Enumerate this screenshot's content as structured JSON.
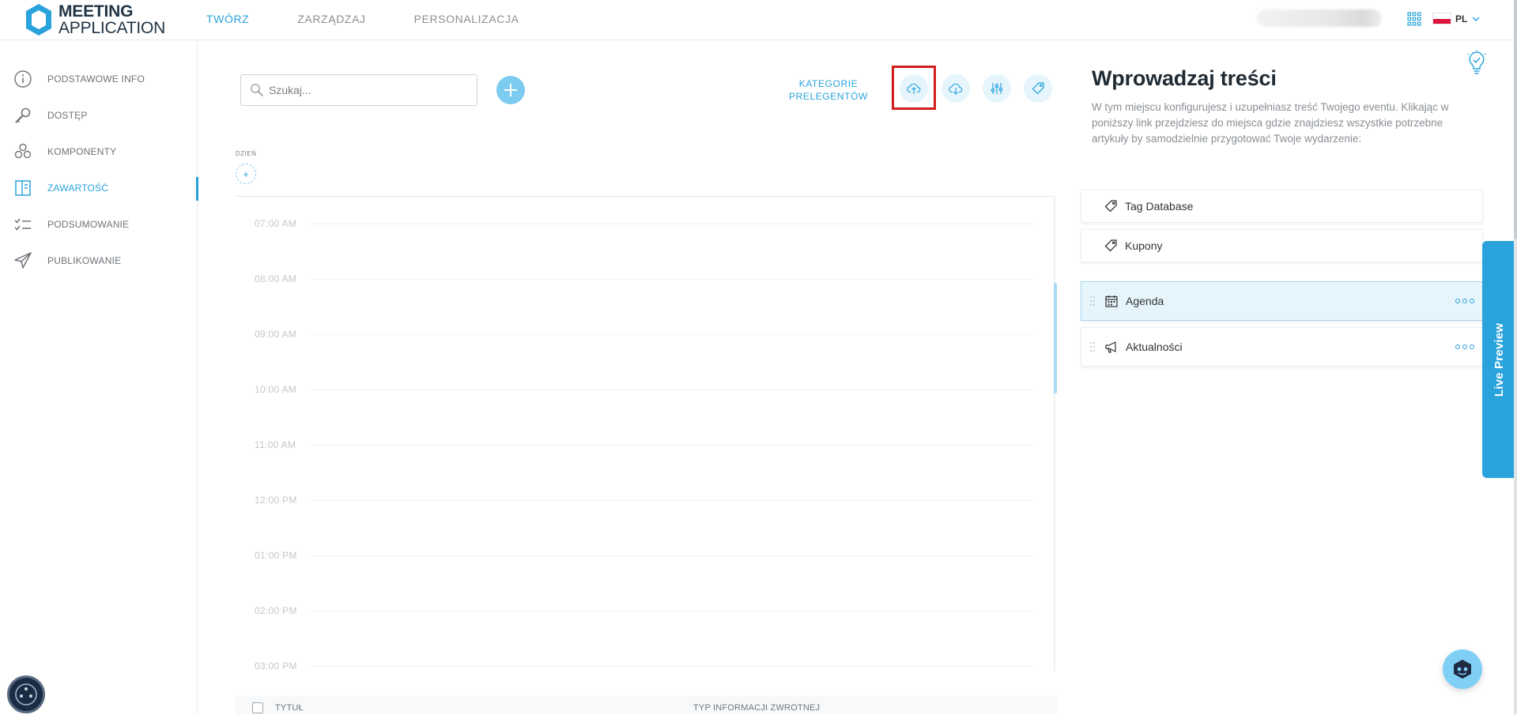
{
  "app": {
    "logo_line1": "MEETING",
    "logo_line2": "APPLICATION",
    "accent_color": "#2aa3dc"
  },
  "topnav": {
    "items": [
      {
        "label": "TWÓRZ",
        "active": true
      },
      {
        "label": "ZARZĄDZAJ",
        "active": false
      },
      {
        "label": "PERSONALIZACJA",
        "active": false
      }
    ]
  },
  "header_right": {
    "language": "PL",
    "icons": [
      "apps-grid-icon",
      "poland-flag-icon",
      "chevron-down-icon",
      "lightbulb-check-icon"
    ]
  },
  "sidebar": {
    "items": [
      {
        "label": "PODSTAWOWE INFO",
        "icon": "info-icon",
        "active": false
      },
      {
        "label": "DOSTĘP",
        "icon": "key-icon",
        "active": false
      },
      {
        "label": "KOMPONENTY",
        "icon": "components-icon",
        "active": false
      },
      {
        "label": "ZAWARTOŚĆ",
        "icon": "content-book-icon",
        "active": true
      },
      {
        "label": "PODSUMOWANIE",
        "icon": "checklist-icon",
        "active": false
      },
      {
        "label": "PUBLIKOWANIE",
        "icon": "paper-plane-icon",
        "active": false
      }
    ]
  },
  "toolbar": {
    "search_placeholder": "Szukaj...",
    "kategorie_line1": "KATEGORIE",
    "kategorie_line2": "PRELEGENTÓW",
    "icon_buttons": [
      "cloud-upload-icon",
      "cloud-download-icon",
      "sliders-icon",
      "tag-icon"
    ]
  },
  "calendar": {
    "day_label": "DZIEŃ",
    "times": [
      "07:00 AM",
      "08:00 AM",
      "09:00 AM",
      "10:00 AM",
      "11:00 AM",
      "12:00 PM",
      "01:00 PM",
      "02:00 PM",
      "03:00 PM"
    ]
  },
  "table": {
    "col_title": "TYTUŁ",
    "col_feedback": "TYP INFORMACJI ZWROTNEJ"
  },
  "right_panel": {
    "title": "Wprowadzaj treści",
    "description": "W tym miejscu konfigurujesz i uzupełniasz treść Twojego eventu. Klikając w poniższy link przejdziesz do miejsca gdzie znajdziesz wszystkie potrzebne artykuły by samodzielnie przygotować Twoje wydarzenie:",
    "cards": [
      {
        "label": "Tag Database",
        "icon": "tag-icon"
      },
      {
        "label": "Kupony",
        "icon": "tag-icon"
      }
    ],
    "modules": [
      {
        "label": "Agenda",
        "icon": "calendar-icon",
        "selected": true
      },
      {
        "label": "Aktualności",
        "icon": "megaphone-icon",
        "selected": false
      }
    ],
    "live_preview": "Live Preview"
  }
}
